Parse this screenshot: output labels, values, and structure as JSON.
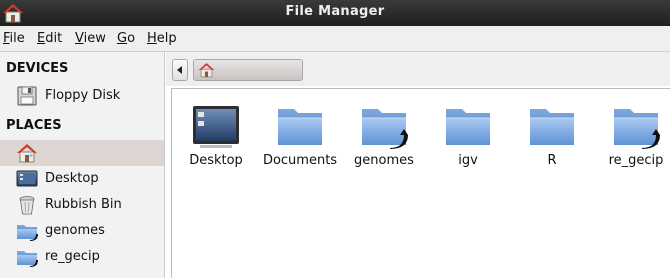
{
  "window": {
    "title": "File Manager",
    "app_icon": "home-folder-icon"
  },
  "menubar": {
    "items": [
      {
        "label": "File",
        "mnemonic": "F",
        "rest": "ile"
      },
      {
        "label": "Edit",
        "mnemonic": "E",
        "rest": "dit"
      },
      {
        "label": "View",
        "mnemonic": "V",
        "rest": "iew"
      },
      {
        "label": "Go",
        "mnemonic": "G",
        "rest": "o"
      },
      {
        "label": "Help",
        "mnemonic": "H",
        "rest": "elp"
      }
    ]
  },
  "sidebar": {
    "devices_header": "DEVICES",
    "devices": [
      {
        "label": "Floppy Disk",
        "icon": "floppy-disk-icon"
      }
    ],
    "places_header": "PLACES",
    "places": [
      {
        "label": "",
        "icon": "home-folder-icon",
        "selected": true
      },
      {
        "label": "Desktop",
        "icon": "desktop-icon",
        "selected": false
      },
      {
        "label": "Rubbish Bin",
        "icon": "trash-icon",
        "selected": false
      },
      {
        "label": "genomes",
        "icon": "folder-icon",
        "selected": false
      },
      {
        "label": "re_gecip",
        "icon": "folder-icon",
        "selected": false
      }
    ]
  },
  "pathbar": {
    "back_icon": "chevron-left-icon",
    "crumb_icon": "home-folder-icon"
  },
  "files": [
    {
      "name": "Desktop",
      "icon": "desktop-icon",
      "symlink": false
    },
    {
      "name": "Documents",
      "icon": "folder-icon",
      "symlink": false
    },
    {
      "name": "genomes",
      "icon": "folder-icon",
      "symlink": true
    },
    {
      "name": "igv",
      "icon": "folder-icon",
      "symlink": false
    },
    {
      "name": "R",
      "icon": "folder-icon",
      "symlink": false
    },
    {
      "name": "re_gecip",
      "icon": "folder-icon",
      "symlink": true
    }
  ],
  "colors": {
    "folder": "#7ba8df",
    "selection": "#dcd5d2",
    "titlebar": "#2a2a2a",
    "home_roof": "#d23a2a"
  }
}
